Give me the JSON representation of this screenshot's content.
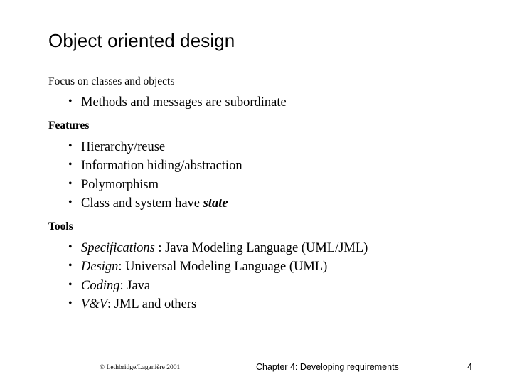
{
  "slide": {
    "title": "Object oriented design",
    "sections": [
      {
        "heading": "Focus on classes and objects",
        "heading_bold": false,
        "bullets": [
          {
            "text": "Methods and messages are subordinate",
            "style": "plain"
          }
        ]
      },
      {
        "heading": "Features",
        "heading_bold": true,
        "bullets": [
          {
            "text": "Hierarchy/reuse",
            "style": "plain"
          },
          {
            "text": "Information hiding/abstraction",
            "style": "plain"
          },
          {
            "text": "Polymorphism",
            "style": "plain"
          },
          {
            "text": "Class and system have ",
            "emphasis": "state",
            "emphasis_style": "bold-italic",
            "style": "mixed"
          }
        ]
      },
      {
        "heading": "Tools",
        "heading_bold": true,
        "bullets": [
          {
            "lead": "Specifications",
            "lead_style": "italic",
            "text": " : Java Modeling Language (UML/JML)",
            "style": "lead"
          },
          {
            "lead": "Design",
            "lead_style": "italic",
            "text": ": Universal Modeling Language (UML)",
            "style": "lead"
          },
          {
            "lead": "Coding",
            "lead_style": "italic",
            "text": ": Java",
            "style": "lead"
          },
          {
            "lead": "V&V",
            "lead_style": "italic",
            "text": ": JML and others",
            "style": "lead"
          }
        ]
      }
    ],
    "bullet_glyph": "•"
  },
  "footer": {
    "copyright": "© Lethbridge/Laganière 2001",
    "chapter": "Chapter 4: Developing requirements",
    "page_number": "4"
  }
}
